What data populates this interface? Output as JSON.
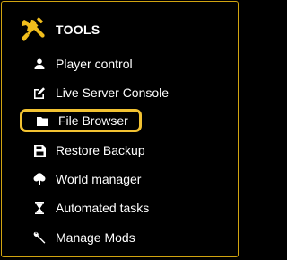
{
  "header": {
    "title": "TOOLS",
    "icon": "tools-icon",
    "icon_color": "#f0bd1c"
  },
  "menu": {
    "highlight_color": "#f2c232",
    "items": [
      {
        "label": "Player control",
        "icon": "person-icon"
      },
      {
        "label": "Live Server Console",
        "icon": "edit-icon"
      },
      {
        "label": "File Browser",
        "icon": "folder-icon",
        "highlighted": true
      },
      {
        "label": "Restore Backup",
        "icon": "save-icon"
      },
      {
        "label": "World manager",
        "icon": "tree-icon"
      },
      {
        "label": "Automated tasks",
        "icon": "hourglass-icon"
      },
      {
        "label": "Manage Mods",
        "icon": "wrench-icon"
      }
    ]
  }
}
